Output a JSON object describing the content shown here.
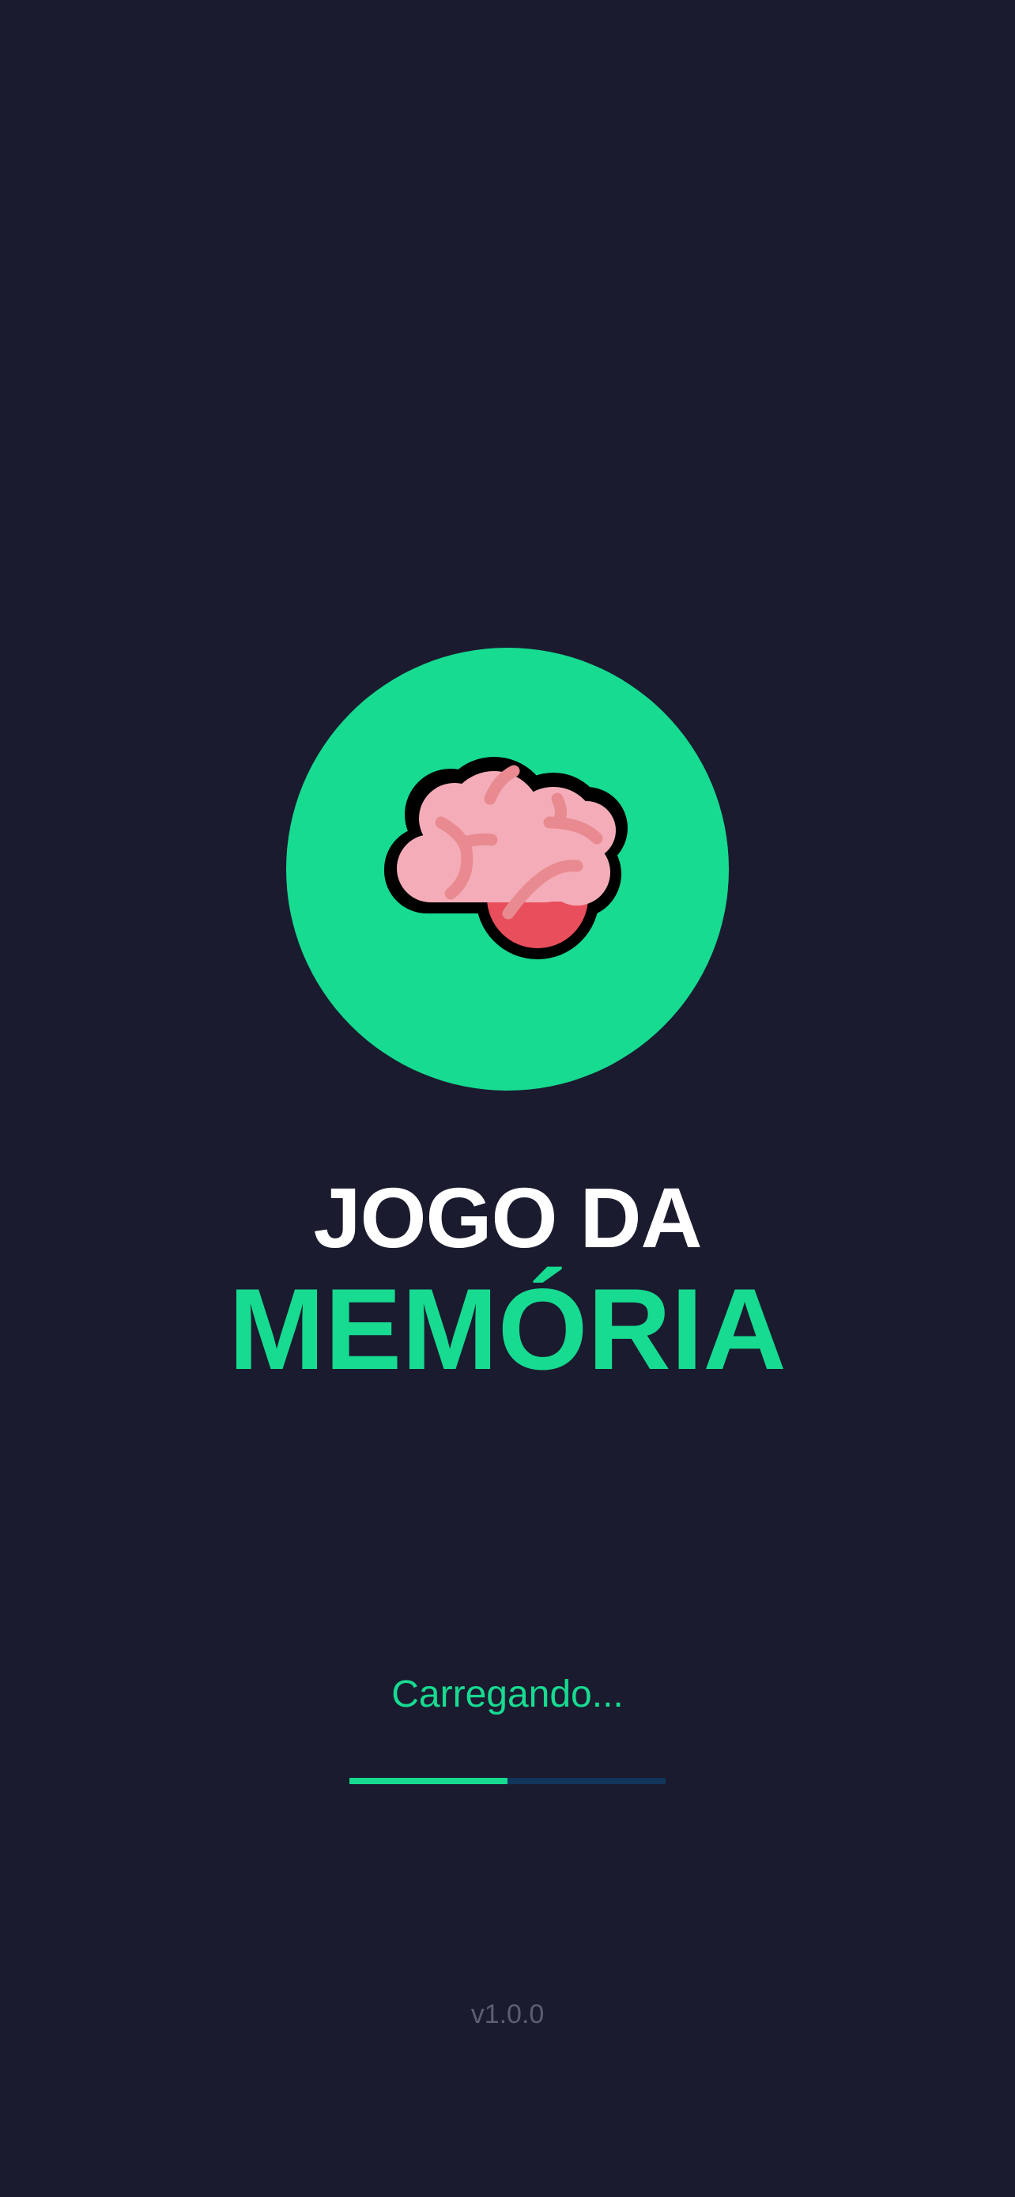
{
  "app": {
    "logo_icon": "brain-icon",
    "title_line1": "JOGO DA",
    "title_line2": "MEMÓRIA"
  },
  "loading": {
    "text": "Carregando...",
    "progress_fraction": 0.5
  },
  "footer": {
    "version": "v1.0.0"
  },
  "colors": {
    "background": "#1a1b2e",
    "accent": "#17db91",
    "title": "#ffffff",
    "progress_track": "#12355c",
    "version_text": "#5c5f70",
    "brain_pink": "#f4adb8",
    "brain_fold": "#e88a8f",
    "brain_stem": "#e84e5c"
  }
}
